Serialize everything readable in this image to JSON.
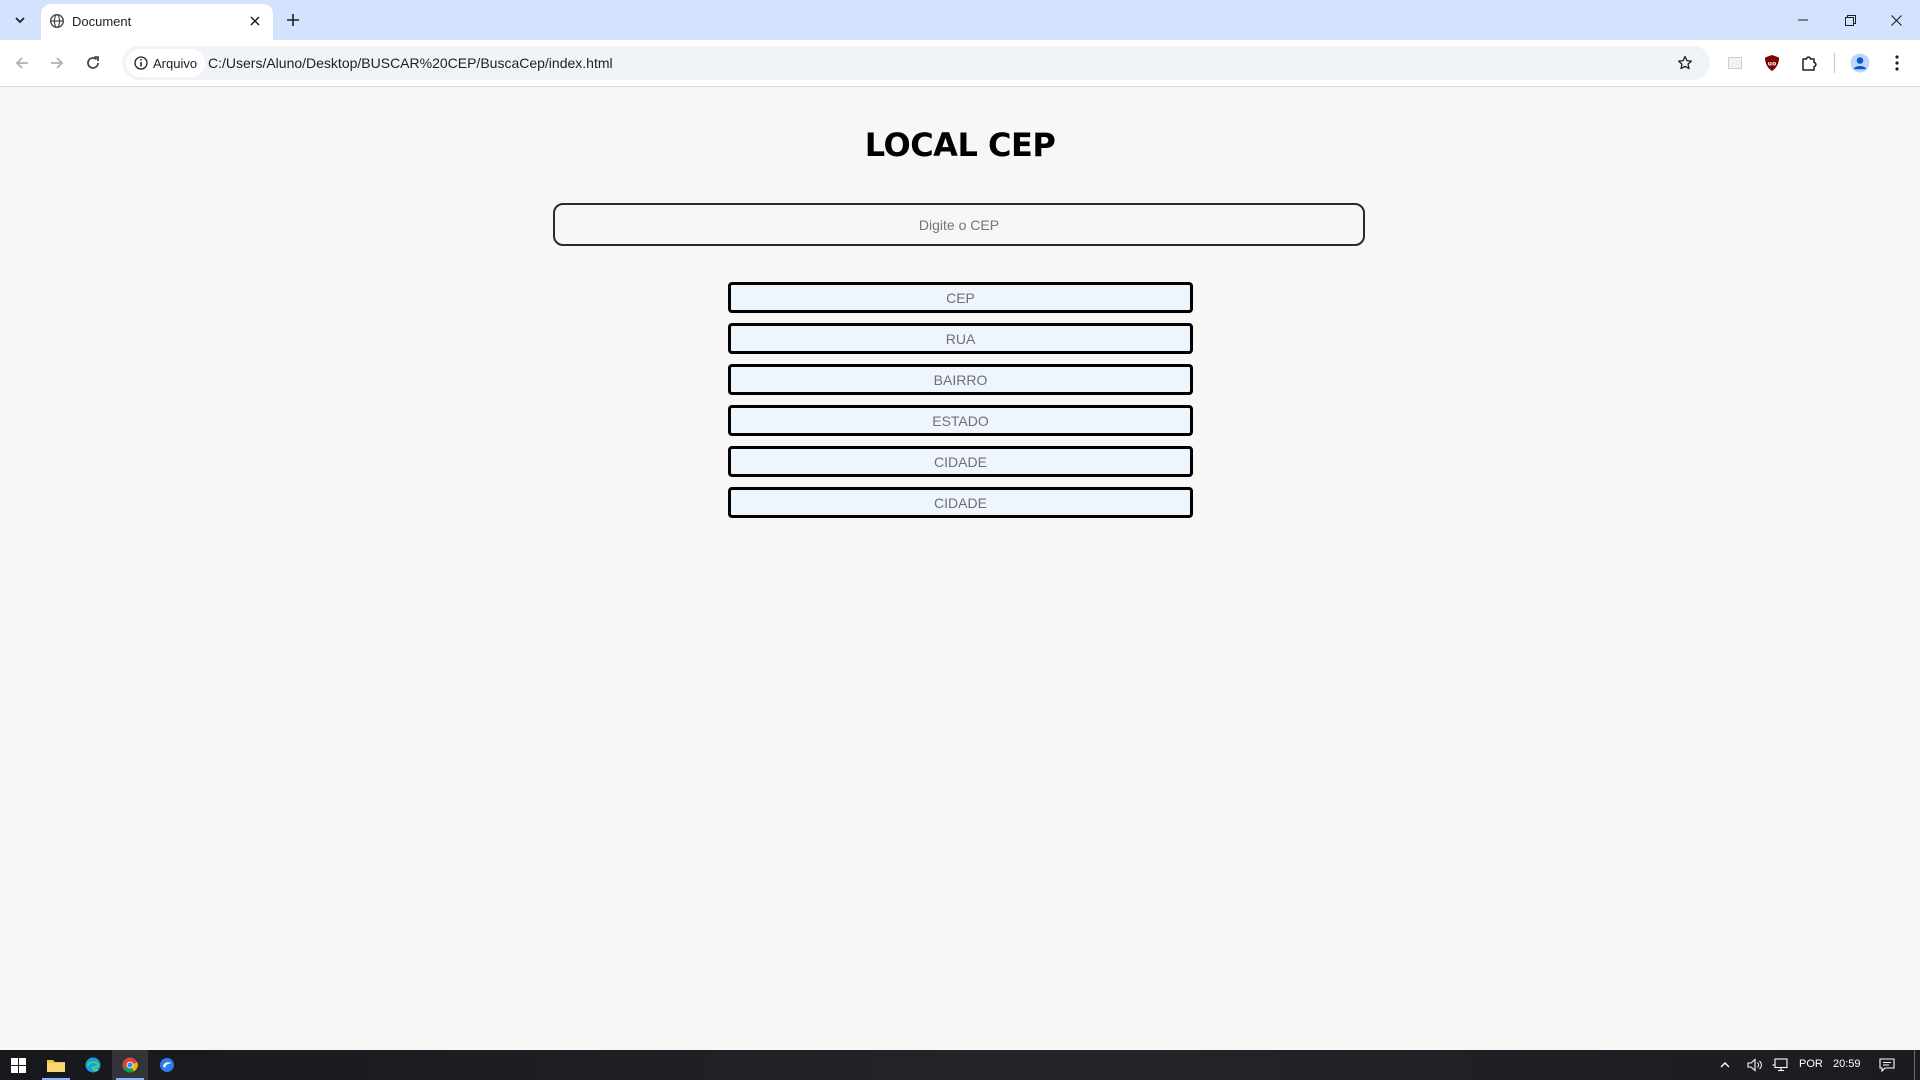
{
  "browser": {
    "tab_title": "Document",
    "site_chip_label": "Arquivo",
    "url": "C:/Users/Aluno/Desktop/BUSCAR%20CEP/BuscaCep/index.html"
  },
  "page": {
    "title": "LOCAL CEP",
    "cep_input_placeholder": "Digite o CEP",
    "fields": [
      {
        "placeholder": "CEP"
      },
      {
        "placeholder": "RUA"
      },
      {
        "placeholder": "BAIRRO"
      },
      {
        "placeholder": "ESTADO"
      },
      {
        "placeholder": "CIDADE"
      },
      {
        "placeholder": "CIDADE"
      }
    ]
  },
  "taskbar": {
    "language": "POR",
    "time": "20:59"
  },
  "colors": {
    "tabstrip": "#d3e3fd",
    "page_background": "#f7f7f7",
    "field_background": "#eef5fd",
    "taskbar": "#1c1c1e"
  },
  "icons": {
    "tab_search": "chevron-down-icon",
    "favicon": "globe-icon",
    "close": "close-icon",
    "new_tab": "plus-icon",
    "back": "arrow-left-icon",
    "forward": "arrow-right-icon",
    "reload": "reload-icon",
    "info": "info-icon",
    "bookmark": "star-icon",
    "extensions": "puzzle-icon",
    "profile": "person-icon",
    "menu": "kebab-menu-icon"
  }
}
